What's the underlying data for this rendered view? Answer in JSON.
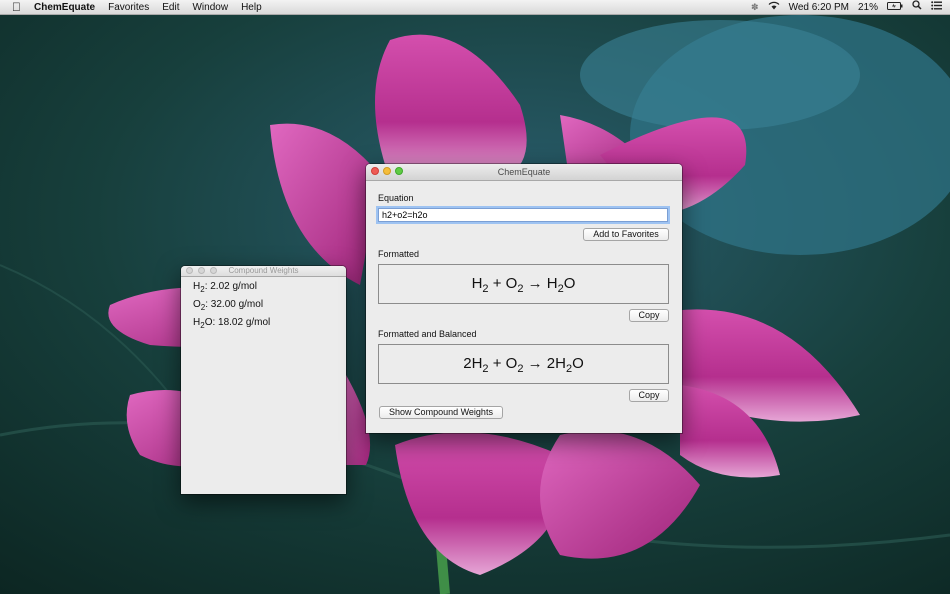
{
  "menubar": {
    "app_name": "ChemEquate",
    "menus": [
      "Favorites",
      "Edit",
      "Window",
      "Help"
    ],
    "clock": "Wed 6:20 PM",
    "battery": "21%"
  },
  "compound_window": {
    "title": "Compound Weights",
    "items": [
      {
        "formula": "H",
        "sub": "2",
        "rest": "",
        "value": ": 2.02 g/mol"
      },
      {
        "formula": "O",
        "sub": "2",
        "rest": "",
        "value": ": 32.00 g/mol"
      },
      {
        "formula": "H",
        "sub": "2",
        "rest": "O",
        "value": ": 18.02 g/mol"
      }
    ]
  },
  "main_window": {
    "title": "ChemEquate",
    "equation_label": "Equation",
    "equation_value": "h2+o2=h2o",
    "add_favorites_label": "Add to Favorites",
    "formatted_label": "Formatted",
    "formatted_balanced_label": "Formatted and Balanced",
    "copy_label": "Copy",
    "show_weights_label": "Show Compound Weights"
  },
  "colors": {
    "petal": "#c0389a",
    "petal_light": "#e07ac5",
    "leaf": "#1f5a58",
    "background": "#12322e"
  }
}
